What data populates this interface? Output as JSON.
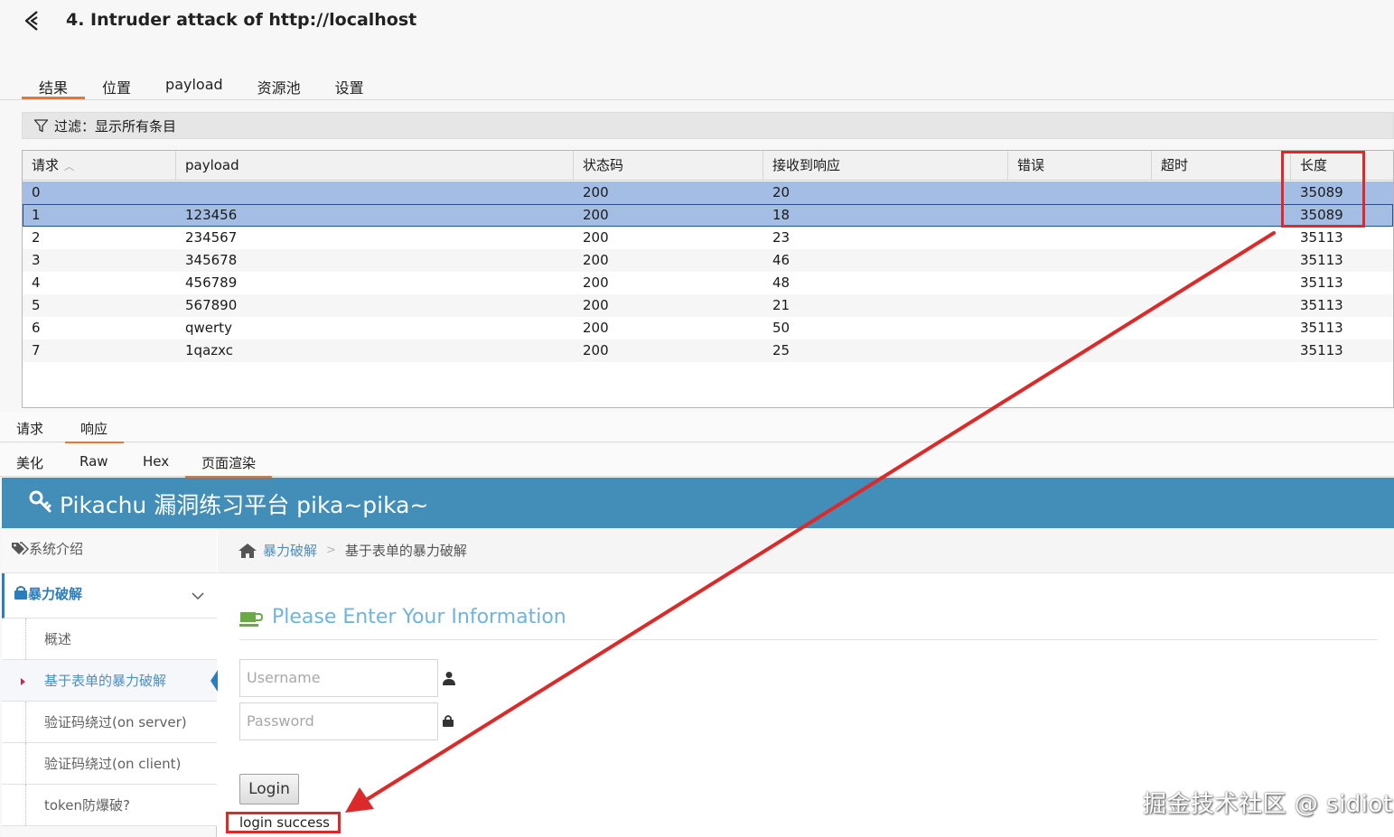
{
  "window": {
    "title": "4. Intruder attack of http://localhost"
  },
  "tabs_main": [
    {
      "label": "结果",
      "active": true
    },
    {
      "label": "位置",
      "active": false
    },
    {
      "label": "payload",
      "active": false
    },
    {
      "label": "资源池",
      "active": false
    },
    {
      "label": "设置",
      "active": false
    }
  ],
  "filter": {
    "text": "过滤：显示所有条目"
  },
  "table": {
    "headers": [
      "请求",
      "payload",
      "状态码",
      "接收到响应",
      "错误",
      "超时",
      "长度"
    ],
    "rows": [
      [
        "0",
        "",
        "200",
        "20",
        "",
        "",
        "35089"
      ],
      [
        "1",
        "123456",
        "200",
        "18",
        "",
        "",
        "35089"
      ],
      [
        "2",
        "234567",
        "200",
        "23",
        "",
        "",
        "35113"
      ],
      [
        "3",
        "345678",
        "200",
        "46",
        "",
        "",
        "35113"
      ],
      [
        "4",
        "456789",
        "200",
        "48",
        "",
        "",
        "35113"
      ],
      [
        "5",
        "567890",
        "200",
        "21",
        "",
        "",
        "35113"
      ],
      [
        "6",
        "qwerty",
        "200",
        "50",
        "",
        "",
        "35113"
      ],
      [
        "7",
        "1qazxc",
        "200",
        "25",
        "",
        "",
        "35113"
      ]
    ]
  },
  "subtabs_req_resp": [
    {
      "label": "请求",
      "active": false
    },
    {
      "label": "响应",
      "active": true
    }
  ],
  "subtabs_view": [
    {
      "label": "美化",
      "active": false
    },
    {
      "label": "Raw",
      "active": false
    },
    {
      "label": "Hex",
      "active": false
    },
    {
      "label": "页面渲染",
      "active": true
    }
  ],
  "rendered": {
    "brand": "Pikachu 漏洞练习平台 pika~pika~",
    "sidebar": {
      "top_item": "系统介绍",
      "open_section": "暴力破解",
      "sub_items": [
        {
          "label": "概述",
          "active": false
        },
        {
          "label": "基于表单的暴力破解",
          "active": true
        },
        {
          "label": "验证码绕过(on server)",
          "active": false
        },
        {
          "label": "验证码绕过(on client)",
          "active": false
        },
        {
          "label": "token防爆破?",
          "active": false
        }
      ]
    },
    "breadcrumb": {
      "link": "暴力破解",
      "current": "基于表单的暴力破解"
    },
    "form": {
      "title": "Please Enter Your Information",
      "username_placeholder": "Username",
      "password_placeholder": "Password",
      "login_label": "Login",
      "result": "login success"
    }
  },
  "watermark": "掘金技术社区 @ sidiot",
  "colors": {
    "accent_tab": "#e8762b",
    "selected_row": "#a3bde4",
    "header_blue": "#438eb9",
    "annotation_red": "#dc2a2a"
  }
}
